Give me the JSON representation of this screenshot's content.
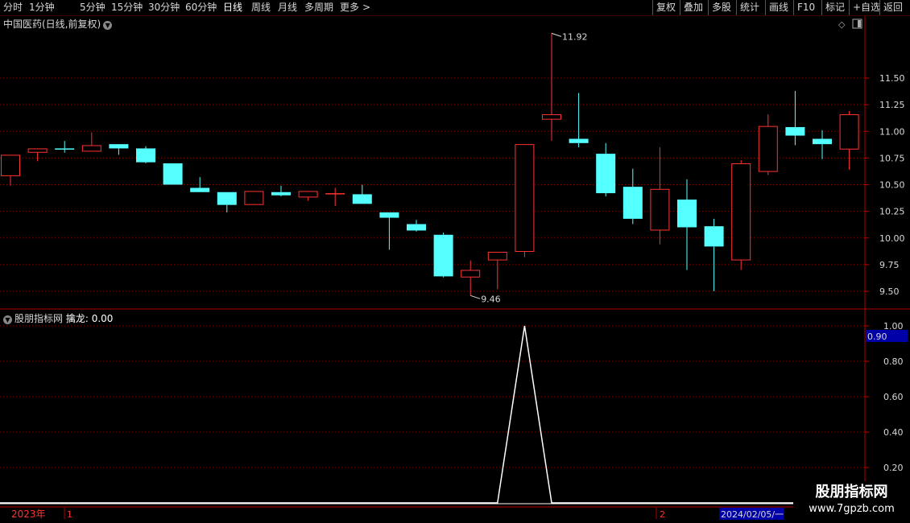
{
  "toolbar": {
    "periods": [
      "分时",
      "1分钟",
      "5分钟",
      "15分钟",
      "30分钟",
      "60分钟",
      "日线",
      "周线",
      "月线",
      "多周期",
      "更多"
    ],
    "active_period": "日线",
    "more_arrow": ">",
    "right_buttons": [
      "复权",
      "叠加",
      "多股",
      "统计",
      "画线",
      "F10",
      "标记",
      "+自选",
      "返回"
    ]
  },
  "main_panel": {
    "title": "中国医药(日线,前复权)",
    "price_ticks": [
      "11.50",
      "11.25",
      "11.00",
      "10.75",
      "10.50",
      "10.25",
      "10.00",
      "9.75",
      "9.50"
    ],
    "high_marker": "11.92",
    "low_marker": "9.46",
    "colors": {
      "up": "#ff3232",
      "down": "#54ffff",
      "grid": "#8b0000",
      "border": "#b00000"
    }
  },
  "sub_panel": {
    "indicator_name": "股朋指标网",
    "series_label": "擒龙",
    "series_value": "0.00",
    "value_ticks": [
      "1.00",
      "0.80",
      "0.60",
      "0.40",
      "0.20"
    ],
    "current_value_badge": "0.90",
    "badge_color": "#0000a8"
  },
  "time_axis": {
    "year_label": "2023年",
    "month_label_1": "1",
    "month_label_2": "2",
    "date_badge": "2024/02/05/一"
  },
  "watermark": {
    "title": "股朋指标网",
    "url": "www.7gpzb.com"
  },
  "chart_data": {
    "type": "candlestick",
    "title": "中国医药(日线,前复权)",
    "ylim": [
      9.35,
      12.0
    ],
    "candles": [
      {
        "open": 10.58,
        "close": 10.78,
        "high": 10.78,
        "low": 10.49
      },
      {
        "open": 10.8,
        "close": 10.84,
        "high": 10.84,
        "low": 10.72
      },
      {
        "open": 10.84,
        "close": 10.83,
        "high": 10.91,
        "low": 10.8
      },
      {
        "open": 10.81,
        "close": 10.87,
        "high": 10.99,
        "low": 10.81
      },
      {
        "open": 10.88,
        "close": 10.84,
        "high": 10.88,
        "low": 10.78
      },
      {
        "open": 10.84,
        "close": 10.71,
        "high": 10.86,
        "low": 10.7
      },
      {
        "open": 10.7,
        "close": 10.5,
        "high": 10.7,
        "low": 10.5
      },
      {
        "open": 10.47,
        "close": 10.43,
        "high": 10.57,
        "low": 10.43
      },
      {
        "open": 10.43,
        "close": 10.31,
        "high": 10.43,
        "low": 10.24
      },
      {
        "open": 10.31,
        "close": 10.44,
        "high": 10.44,
        "low": 10.31
      },
      {
        "open": 10.43,
        "close": 10.4,
        "high": 10.49,
        "low": 10.39
      },
      {
        "open": 10.38,
        "close": 10.44,
        "high": 10.44,
        "low": 10.35
      },
      {
        "open": 10.42,
        "close": 10.42,
        "high": 10.47,
        "low": 10.3
      },
      {
        "open": 10.41,
        "close": 10.32,
        "high": 10.5,
        "low": 10.32
      },
      {
        "open": 10.24,
        "close": 10.19,
        "high": 10.24,
        "low": 9.89
      },
      {
        "open": 10.13,
        "close": 10.07,
        "high": 10.17,
        "low": 10.06
      },
      {
        "open": 10.03,
        "close": 9.64,
        "high": 10.05,
        "low": 9.63
      },
      {
        "open": 9.63,
        "close": 9.7,
        "high": 9.79,
        "low": 9.46
      },
      {
        "open": 9.79,
        "close": 9.87,
        "high": 9.87,
        "low": 9.52
      },
      {
        "open": 9.87,
        "close": 10.88,
        "high": 10.88,
        "low": 9.82
      },
      {
        "open": 11.11,
        "close": 11.16,
        "high": 11.92,
        "low": 10.91
      },
      {
        "open": 10.93,
        "close": 10.89,
        "high": 11.36,
        "low": 10.85
      },
      {
        "open": 10.79,
        "close": 10.42,
        "high": 10.89,
        "low": 10.39
      },
      {
        "open": 10.48,
        "close": 10.18,
        "high": 10.65,
        "low": 10.13
      },
      {
        "open": 10.07,
        "close": 10.46,
        "high": 10.85,
        "low": 9.94
      },
      {
        "open": 10.36,
        "close": 10.1,
        "high": 10.55,
        "low": 9.7
      },
      {
        "open": 10.11,
        "close": 9.92,
        "high": 10.18,
        "low": 9.5
      },
      {
        "open": 9.79,
        "close": 10.7,
        "high": 10.73,
        "low": 9.7
      },
      {
        "open": 10.62,
        "close": 11.05,
        "high": 11.16,
        "low": 10.59
      },
      {
        "open": 11.04,
        "close": 10.96,
        "high": 11.38,
        "low": 10.87
      },
      {
        "open": 10.93,
        "close": 10.88,
        "high": 11.01,
        "low": 10.74
      },
      {
        "open": 10.83,
        "close": 11.16,
        "high": 11.19,
        "low": 10.64
      }
    ],
    "indicator": {
      "name": "擒龙",
      "ylim": [
        0,
        1.0
      ],
      "values": [
        0,
        0,
        0,
        0,
        0,
        0,
        0,
        0,
        0,
        0,
        0,
        0,
        0,
        0,
        0,
        0,
        0,
        0,
        0,
        1,
        0,
        0,
        0,
        0,
        0,
        0,
        0,
        0,
        0,
        0,
        0,
        0
      ]
    }
  }
}
